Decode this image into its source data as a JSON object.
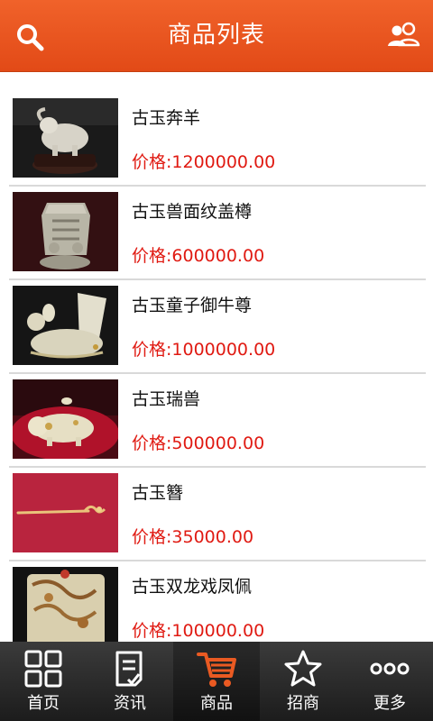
{
  "header": {
    "title": "商品列表",
    "search_icon": "search-icon",
    "user_icon": "users-icon",
    "background": "#e8541f"
  },
  "price_label": "价格:",
  "price_color": "#e01a12",
  "items": [
    {
      "name": "古玉奔羊",
      "price": "1200000.00",
      "image": "jade-ram"
    },
    {
      "name": "古玉兽面纹盖樽",
      "price": "600000.00",
      "image": "jade-vessel"
    },
    {
      "name": "古玉童子御牛尊",
      "price": "1000000.00",
      "image": "jade-ox-cup"
    },
    {
      "name": "古玉瑞兽",
      "price": "500000.00",
      "image": "jade-beast"
    },
    {
      "name": "古玉簪",
      "price": "35000.00",
      "image": "jade-hairpin"
    },
    {
      "name": "古玉双龙戏凤佩",
      "price": "100000.00",
      "image": "jade-pendant"
    }
  ],
  "tabs": [
    {
      "label": "首页",
      "icon": "grid-icon",
      "active": false
    },
    {
      "label": "资讯",
      "icon": "document-icon",
      "active": false
    },
    {
      "label": "商品",
      "icon": "cart-icon",
      "active": true
    },
    {
      "label": "招商",
      "icon": "star-icon",
      "active": false
    },
    {
      "label": "更多",
      "icon": "more-icon",
      "active": false
    }
  ],
  "accent_color": "#e8541f"
}
